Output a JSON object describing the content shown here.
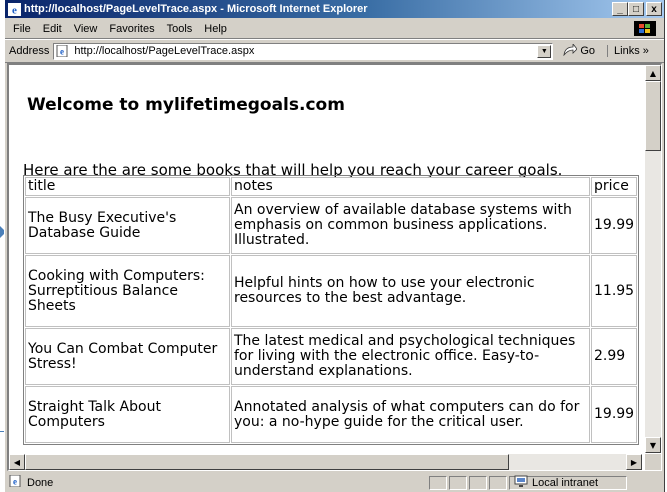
{
  "window": {
    "title": "http://localhost/PageLevelTrace.aspx - Microsoft Internet Explorer",
    "buttons": {
      "minimize": "_",
      "maximize": "□",
      "close": "x"
    }
  },
  "menu": [
    "File",
    "Edit",
    "View",
    "Favorites",
    "Tools",
    "Help"
  ],
  "address": {
    "label": "Address",
    "url": "http://localhost/PageLevelTrace.aspx",
    "go": "Go",
    "links": "Links »"
  },
  "page": {
    "heading": "Welcome to mylifetimegoals.com",
    "intro": "Here are the are some books that will help you reach your career goals."
  },
  "table": {
    "headers": {
      "title": "title",
      "notes": "notes",
      "price": "price"
    },
    "rows": [
      {
        "title": "The Busy Executive's Database Guide",
        "notes": "An overview of available database systems with emphasis on common business applications. Illustrated.",
        "price": "19.99"
      },
      {
        "title": "Cooking with Computers: Surreptitious Balance Sheets",
        "notes": "Helpful hints on how to use your electronic resources to the best advantage.",
        "price": "11.95"
      },
      {
        "title": "You Can Combat Computer Stress!",
        "notes": "The latest medical and psychological techniques for living with the electronic office. Easy-to-understand explanations.",
        "price": "2.99"
      },
      {
        "title": "Straight Talk About Computers",
        "notes": "Annotated analysis of what computers can do for you: a no-hype guide for the critical user.",
        "price": "19.99"
      }
    ]
  },
  "status": {
    "text": "Done",
    "zone": "Local intranet"
  },
  "colors": {
    "titlebar_start": "#0a246a",
    "titlebar_end": "#a6caf0",
    "chrome": "#d4d0c8",
    "annotation": "#4a7fb8"
  },
  "icons": [
    "ie-logo-icon",
    "windows-logo-icon",
    "page-icon",
    "dropdown-arrow-icon",
    "go-arrow-icon",
    "scroll-up-icon",
    "scroll-down-icon",
    "scroll-left-icon",
    "scroll-right-icon",
    "done-page-icon",
    "intranet-icon"
  ]
}
